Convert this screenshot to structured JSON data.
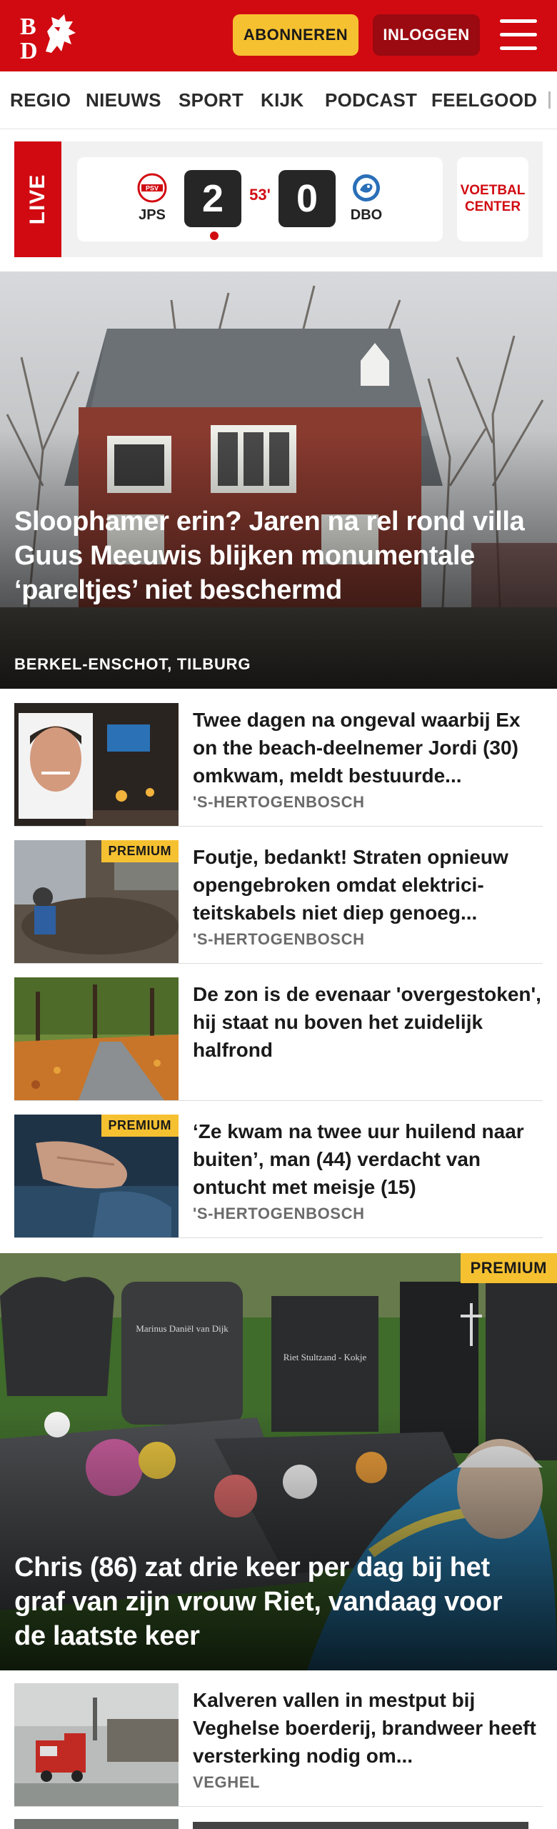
{
  "header": {
    "logo_text": "BD",
    "subscribe_label": "ABONNEREN",
    "login_label": "INLOGGEN",
    "menu_icon": "hamburger-icon"
  },
  "nav": {
    "items": [
      "REGIO",
      "NIEUWS",
      "SPORT",
      "KIJK",
      "PODCAST",
      "FEELGOOD"
    ]
  },
  "live": {
    "label": "LIVE",
    "home_team": "JPS",
    "home_badge_text": "PSV",
    "home_score": "2",
    "minute": "53'",
    "away_score": "0",
    "away_team": "DBO",
    "center_label_1": "VOETBAL",
    "center_label_2": "CENTER",
    "accent_color": "#d10a11"
  },
  "hero1": {
    "title": "Sloophamer erin? Jaren na rel rond villa Guus Meeuwis blijken monumentale ‘pareltjes’ niet beschermd",
    "location": "BERKEL-ENSCHOT, TILBURG"
  },
  "list1": [
    {
      "title": "Twee dagen na ongeval waarbij Ex on the beach-deelnemer Jordi (30) omkwam, meldt bestuurde...",
      "location": "'S-HERTOGENBOSCH",
      "premium": ""
    },
    {
      "title": "Foutje, bedankt! Straten opnieuw opengebroken omdat elektrici­teitskabels niet diep genoeg...",
      "location": "'S-HERTOGENBOSCH",
      "premium": "PREMIUM"
    },
    {
      "title": "De zon is de evenaar 'overgesto­ken', hij staat nu boven het zuidelijk halfrond",
      "location": "",
      "premium": ""
    },
    {
      "title": "‘Ze kwam na twee uur huilend naar buiten’, man (44) verdacht van ontucht met meisje (15)",
      "location": "'S-HERTOGENBOSCH",
      "premium": "PREMIUM"
    }
  ],
  "hero2": {
    "premium": "PREMIUM",
    "title": "Chris (86) zat drie keer per dag bij het graf van zijn vrouw Riet, vandaag voor de laatste keer",
    "gravestone_1": "Marinus Daniël van Dijk",
    "gravestone_2": "Riet Stultzand - Kokje"
  },
  "list2": [
    {
      "title": "Kalveren vallen in mestput bij Veghelse boerderij, brandweer heeft versterking nodig om...",
      "location": "VEGHEL"
    }
  ],
  "colors": {
    "brand_red": "#d10a11",
    "subscribe_yellow": "#f6c131",
    "login_dark_red": "#9b0911"
  }
}
